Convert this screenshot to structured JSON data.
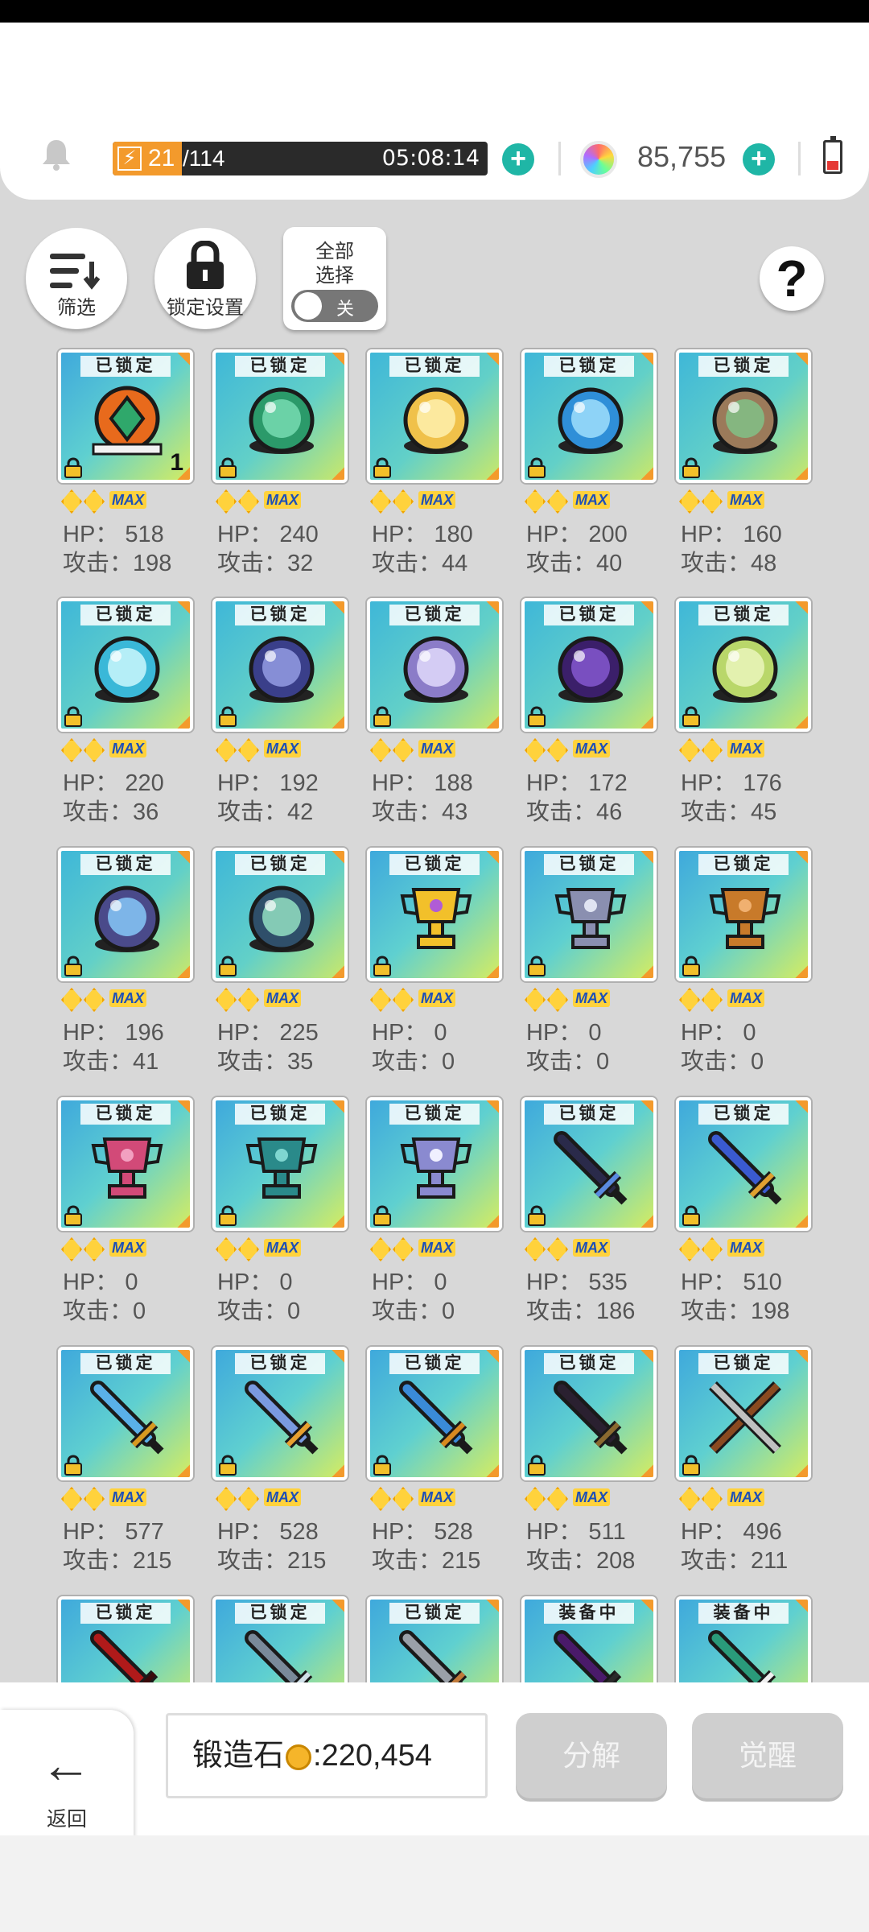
{
  "header": {
    "energy_current": "21",
    "energy_max": "/114",
    "energy_fraction": 0.184,
    "energy_timer": "05:08:14",
    "gem_value": "85,755",
    "battery_level": 0.3
  },
  "toolbar": {
    "filter_label": "筛选",
    "lock_settings_label": "锁定设置",
    "select_all_line1": "全部",
    "select_all_line2": "选择",
    "toggle_state": "关",
    "help_label": "?"
  },
  "items": [
    {
      "status": "已锁定",
      "hp": "HP： 518",
      "atk": "攻击：198",
      "qty": "1",
      "art": "amulet-orange"
    },
    {
      "status": "已锁定",
      "hp": "HP： 240",
      "atk": "攻击：32",
      "art": "orb-green"
    },
    {
      "status": "已锁定",
      "hp": "HP： 180",
      "atk": "攻击：44",
      "art": "orb-gold"
    },
    {
      "status": "已锁定",
      "hp": "HP： 200",
      "atk": "攻击：40",
      "art": "orb-blue"
    },
    {
      "status": "已锁定",
      "hp": "HP： 160",
      "atk": "攻击：48",
      "art": "orb-earth"
    },
    {
      "status": "已锁定",
      "hp": "HP： 220",
      "atk": "攻击：36",
      "art": "orb-ice"
    },
    {
      "status": "已锁定",
      "hp": "HP： 192",
      "atk": "攻击：42",
      "art": "orb-night"
    },
    {
      "status": "已锁定",
      "hp": "HP： 188",
      "atk": "攻击：43",
      "art": "orb-violet"
    },
    {
      "status": "已锁定",
      "hp": "HP： 172",
      "atk": "攻击：46",
      "art": "orb-dark"
    },
    {
      "status": "已锁定",
      "hp": "HP： 176",
      "atk": "攻击：45",
      "art": "orb-lime"
    },
    {
      "status": "已锁定",
      "hp": "HP： 196",
      "atk": "攻击：41",
      "art": "orb-compass"
    },
    {
      "status": "已锁定",
      "hp": "HP： 225",
      "atk": "攻击：35",
      "art": "orb-mountain"
    },
    {
      "status": "已锁定",
      "hp": "HP： 0",
      "atk": "攻击：0",
      "art": "trophy-gold"
    },
    {
      "status": "已锁定",
      "hp": "HP： 0",
      "atk": "攻击：0",
      "art": "trophy-silver"
    },
    {
      "status": "已锁定",
      "hp": "HP： 0",
      "atk": "攻击：0",
      "art": "trophy-bronze"
    },
    {
      "status": "已锁定",
      "hp": "HP： 0",
      "atk": "攻击：0",
      "art": "trophy-pink"
    },
    {
      "status": "已锁定",
      "hp": "HP： 0",
      "atk": "攻击：0",
      "art": "trophy-teal"
    },
    {
      "status": "已锁定",
      "hp": "HP： 0",
      "atk": "攻击：0",
      "art": "trophy-wing"
    },
    {
      "status": "已锁定",
      "hp": "HP： 535",
      "atk": "攻击：186",
      "art": "sword-dark"
    },
    {
      "status": "已锁定",
      "hp": "HP： 510",
      "atk": "攻击：198",
      "art": "sword-blue"
    },
    {
      "status": "已锁定",
      "hp": "HP： 577",
      "atk": "攻击：215",
      "art": "sword-ice"
    },
    {
      "status": "已锁定",
      "hp": "HP： 528",
      "atk": "攻击：215",
      "art": "sword-rainbow"
    },
    {
      "status": "已锁定",
      "hp": "HP： 528",
      "atk": "攻击：215",
      "art": "sword-aqua"
    },
    {
      "status": "已锁定",
      "hp": "HP： 511",
      "atk": "攻击：208",
      "art": "scythe-dark"
    },
    {
      "status": "已锁定",
      "hp": "HP： 496",
      "atk": "攻击：211",
      "art": "crossed-weapons"
    },
    {
      "status": "已锁定",
      "art": "blade-red"
    },
    {
      "status": "已锁定",
      "art": "blade-curved"
    },
    {
      "status": "已锁定",
      "art": "blade-steel"
    },
    {
      "status": "装备中",
      "art": "sword-purple"
    },
    {
      "status": "装备中",
      "art": "blade-feather"
    }
  ],
  "footer": {
    "back_label": "返回",
    "stone_label": "锻造石",
    "stone_value": ":220,454",
    "disassemble_label": "分解",
    "awaken_label": "觉醒"
  }
}
